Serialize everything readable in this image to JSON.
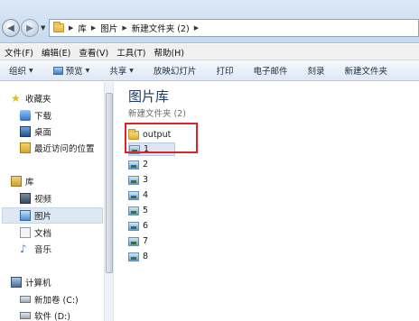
{
  "address": {
    "crumbs": [
      "库",
      "图片",
      "新建文件夹 (2)"
    ]
  },
  "menu": [
    "文件(F)",
    "编辑(E)",
    "查看(V)",
    "工具(T)",
    "帮助(H)"
  ],
  "toolbar": {
    "organize": "组织",
    "preview": "预览",
    "share": "共享",
    "slideshow": "放映幻灯片",
    "print": "打印",
    "email": "电子邮件",
    "burn": "刻录",
    "new_folder": "新建文件夹"
  },
  "nav": {
    "favorites": "收藏夹",
    "downloads": "下载",
    "desktop": "桌面",
    "recent": "最近访问的位置",
    "libraries": "库",
    "videos": "视频",
    "pictures": "图片",
    "documents": "文档",
    "music": "音乐",
    "computer": "计算机",
    "drive_c": "新加卷 (C:)",
    "drive_d": "软件 (D:)"
  },
  "main": {
    "title": "图片库",
    "subtitle": "新建文件夹 (2)",
    "folder": "output",
    "files": [
      "1",
      "2",
      "3",
      "4",
      "5",
      "6",
      "7",
      "8"
    ]
  },
  "colors": {
    "highlight_box": "#d9252a",
    "library_title": "#1e3a66"
  }
}
